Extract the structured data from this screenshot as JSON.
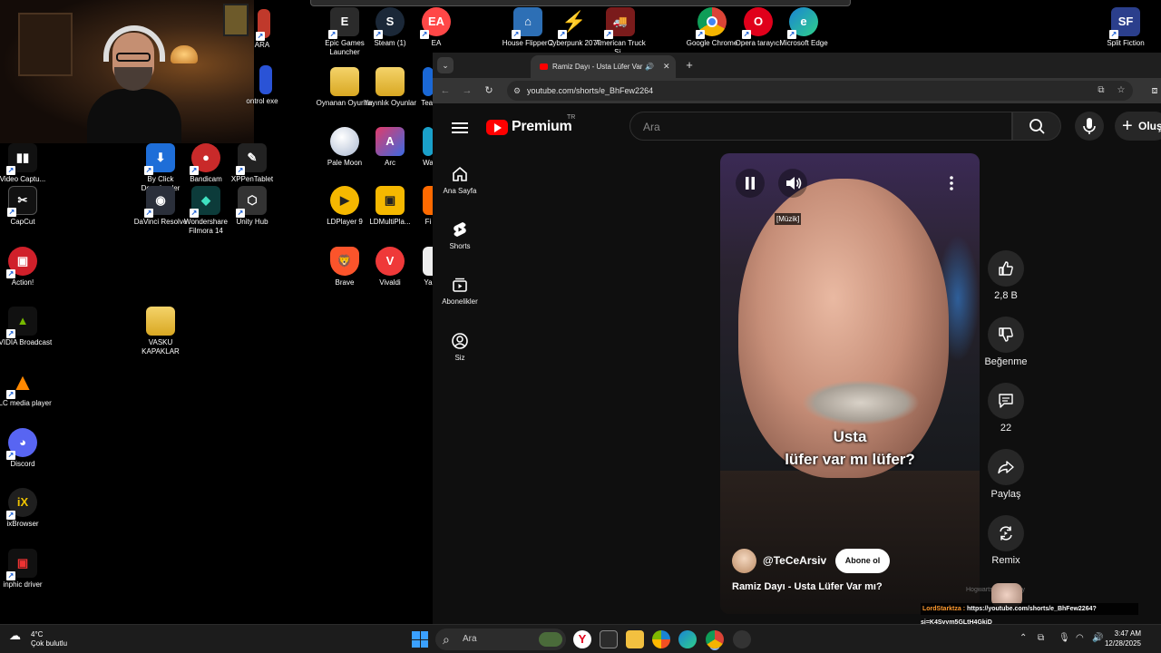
{
  "desktop": {
    "icons": [
      {
        "label": "ARA",
        "color": "#c0392b"
      },
      {
        "label": "Epic Games Launcher",
        "color": "#2b2b2b"
      },
      {
        "label": "Steam (1)",
        "color": "#1b2838"
      },
      {
        "label": "EA",
        "color": "#ff4747"
      },
      {
        "label": "House Flipper 2",
        "color": "#2d6fb5"
      },
      {
        "label": "Cyberpunk 2077",
        "color": "#b01e2e"
      },
      {
        "label": "American Truck Si...",
        "color": "#7a1b1b"
      },
      {
        "label": "Google Chrome",
        "color": "#e8e8e8"
      },
      {
        "label": "Opera tarayıcı",
        "color": "#e0001b"
      },
      {
        "label": "Microsoft Edge",
        "color": "#1a84d4"
      },
      {
        "label": "Split Fiction",
        "color": "#2b3f8c"
      },
      {
        "label": "ontrol exe",
        "color": "#2a53d6"
      },
      {
        "label": "Oynanan Oyunlar",
        "color": "folder"
      },
      {
        "label": "Yayınlık Oyunlar",
        "color": "folder"
      },
      {
        "label": "Tear",
        "color": "#333"
      },
      {
        "label": "Video Captu...",
        "color": "#111"
      },
      {
        "label": "By Click Downloader",
        "color": "#1e6ed8"
      },
      {
        "label": "Bandicam",
        "color": "#c92a2a"
      },
      {
        "label": "XPPenTablet",
        "color": "#222"
      },
      {
        "label": "Pale Moon",
        "color": "#cfd8e8"
      },
      {
        "label": "Arc",
        "color": "#e23b6a"
      },
      {
        "label": "Wa",
        "color": "#1aa0c9"
      },
      {
        "label": "CapCut",
        "color": "#111"
      },
      {
        "label": "DaVinci Resolve",
        "color": "#2a2f3a"
      },
      {
        "label": "Wondershare Filmora 14",
        "color": "#0c3b3a"
      },
      {
        "label": "Unity Hub",
        "color": "#333"
      },
      {
        "label": "LDPlayer 9",
        "color": "#f5b800"
      },
      {
        "label": "LDMultiPla...",
        "color": "#f5b800"
      },
      {
        "label": "Fi",
        "color": "#ff6a00"
      },
      {
        "label": "Action!",
        "color": "#d0202a"
      },
      {
        "label": "Brave",
        "color": "#fb542b"
      },
      {
        "label": "Vivaldi",
        "color": "#ef3939"
      },
      {
        "label": "Ya",
        "color": "#eee"
      },
      {
        "label": "NVIDIA Broadcast",
        "color": "#111"
      },
      {
        "label": "VASKU KAPAKLAR",
        "color": "folder"
      },
      {
        "label": "VLC media player",
        "color": "#111"
      },
      {
        "label": "Discord",
        "color": "#5865f2"
      },
      {
        "label": "ixBrowser",
        "color": "#1f1f1f"
      },
      {
        "label": "inphic driver",
        "color": "#111"
      }
    ]
  },
  "browser": {
    "tab_title": "Ramiz Dayı - Usta Lüfer Var",
    "url": "youtube.com/shorts/e_BhFew2264"
  },
  "youtube": {
    "logo_text": "Premium",
    "country_code": "TR",
    "search_placeholder": "Ara",
    "create_label": "Oluş",
    "sidebar": [
      {
        "label": "Ana Sayfa",
        "icon": "home-icon"
      },
      {
        "label": "Shorts",
        "icon": "shorts-icon"
      },
      {
        "label": "Abonelikler",
        "icon": "subscriptions-icon"
      },
      {
        "label": "Siz",
        "icon": "account-icon"
      }
    ],
    "short": {
      "music_tag": "[Müzik]",
      "subtitle_line1": "Usta",
      "subtitle_line2": "lüfer var mı lüfer?",
      "channel": "@TeCeArsiv",
      "subscribe_label": "Abone ol",
      "title": "Ramiz Dayı - Usta Lüfer Var mı?"
    },
    "actions": {
      "like_count": "2,8 B",
      "dislike_label": "Beğenme",
      "comments_count": "22",
      "share_label": "Paylaş",
      "remix_label": "Remix"
    }
  },
  "chat_overlay": {
    "line1": "HogwartsMaster : Ey",
    "line2_name": "LordStarktza :",
    "line2_text": "https://youtube.com/shorts/e_BhFew2264?",
    "line3": "si=K4Svym5GLtH4GkjD"
  },
  "taskbar": {
    "temperature": "4°C",
    "weather_text": "Çok bulutlu",
    "search_placeholder": "Ara",
    "time": "3:47 AM",
    "date": "12/28/2025"
  }
}
